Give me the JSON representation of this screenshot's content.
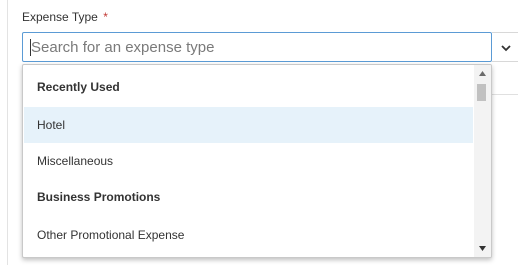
{
  "field": {
    "label": "Expense Type",
    "required_marker": "*"
  },
  "search": {
    "placeholder": "Search for an expense type",
    "value": ""
  },
  "toggle": {
    "icon": "chevron-down-icon"
  },
  "dropdown": {
    "options": [
      {
        "label": "Recently Used",
        "kind": "group"
      },
      {
        "label": "Hotel",
        "kind": "item",
        "highlighted": true
      },
      {
        "label": "Miscellaneous",
        "kind": "item"
      },
      {
        "label": "Business Promotions",
        "kind": "group"
      },
      {
        "label": "Other Promotional Expense",
        "kind": "item"
      }
    ],
    "scroll_position": 0.0
  },
  "colors": {
    "focus_border": "#5b9bd5",
    "highlight": "#e6f2fa",
    "required": "#c23934"
  }
}
